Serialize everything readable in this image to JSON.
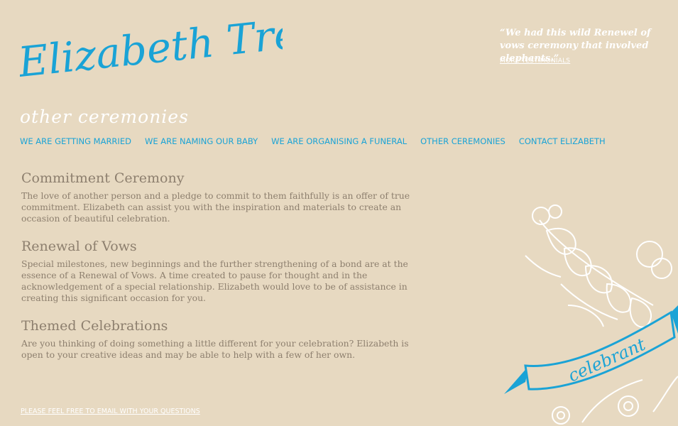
{
  "brand": {
    "logo_text": "Elizabeth Trevan",
    "page_subtitle": "other ceremonies"
  },
  "testimonial": {
    "quote": "“We had this wild Renewel of vows ceremony that involved elephants.”",
    "more_link": "MORE TESTIMONIALS"
  },
  "nav": {
    "items": [
      {
        "label": "WE ARE GETTING MARRIED"
      },
      {
        "label": "WE ARE NAMING OUR BABY"
      },
      {
        "label": "WE ARE ORGANISING A FUNERAL"
      },
      {
        "label": "OTHER CEREMONIES"
      },
      {
        "label": "CONTACT ELIZABETH"
      }
    ]
  },
  "sections": [
    {
      "heading": "Commitment Ceremony",
      "body": "The love of another person and a pledge to commit to them faithfully is an offer of true commitment. Elizabeth can assist you with the inspiration and materials to create an occasion of beautiful celebration."
    },
    {
      "heading": "Renewal of Vows",
      "body": "Special milestones, new beginnings and the further strengthening of a bond are at the essence of a Renewal of Vows.  A time created to pause for thought and in the acknowledgement of a special relationship.  Elizabeth would love to be of assistance in creating this significant occasion for you."
    },
    {
      "heading": "Themed Celebrations",
      "body": "Are you thinking of doing something a little different for your celebration? Elizabeth is open to your creative ideas and may be able to help with a few of her own."
    }
  ],
  "footer": {
    "email_link": "PLEASE FEEL FREE TO EMAIL WITH YOUR QUESTIONS"
  },
  "decoration": {
    "banner_text": "celebrant",
    "accent_color": "#1aa3d6",
    "background_color": "#e7d9c1"
  }
}
